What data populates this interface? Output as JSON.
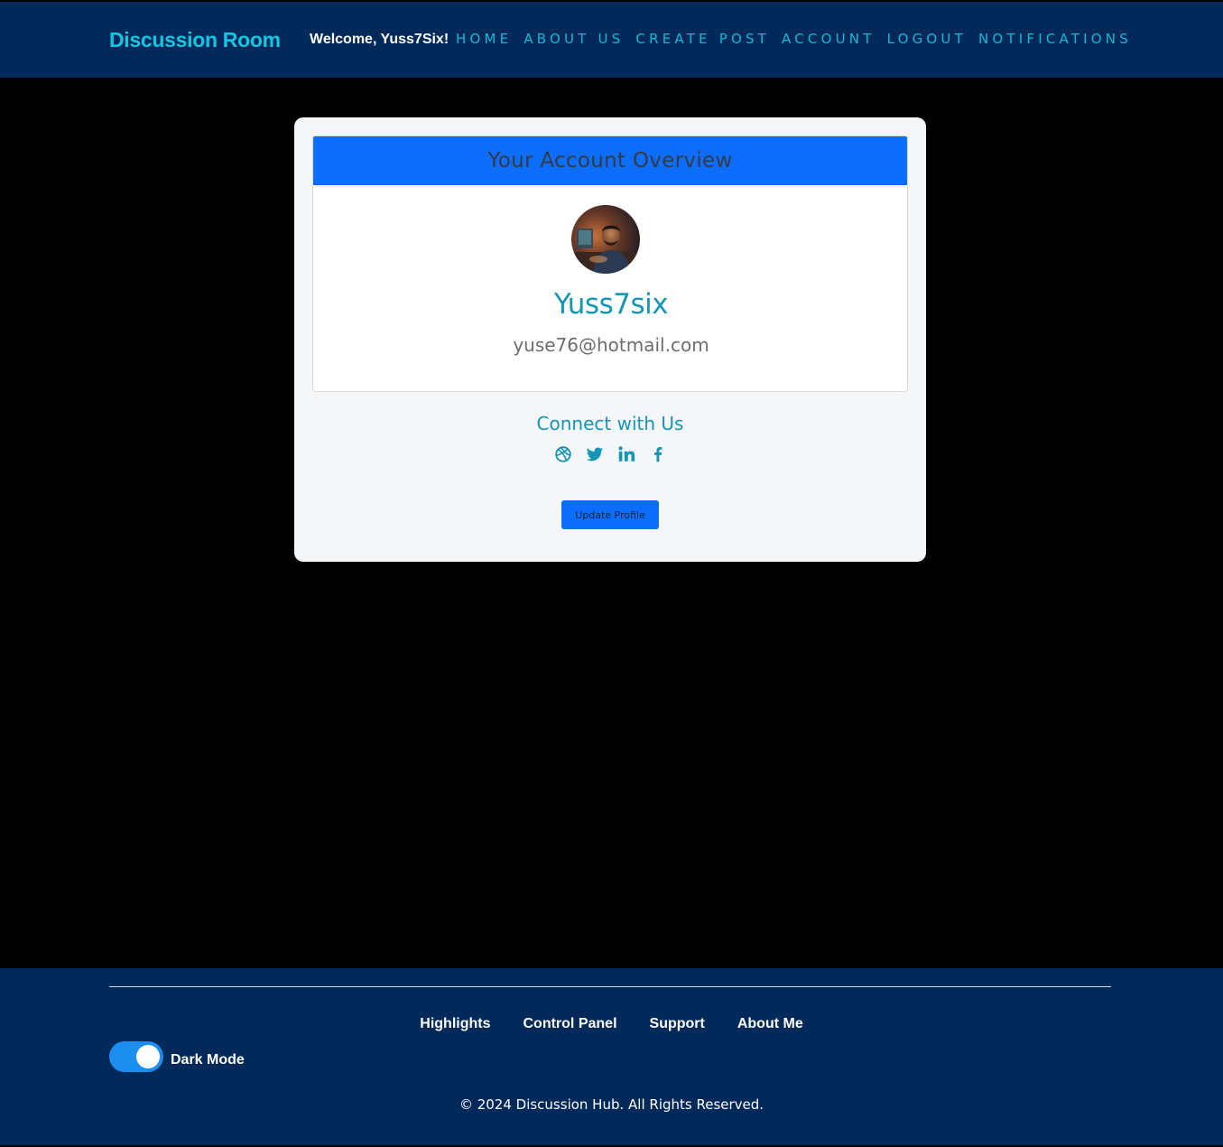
{
  "navbar": {
    "brand": "Discussion Room",
    "welcome": "Welcome, Yuss7Six!",
    "links": [
      "HOME",
      "ABOUT US",
      "CREATE POST",
      "ACCOUNT",
      "LOGOUT",
      "NOTIFICATIONS"
    ]
  },
  "account": {
    "header": "Your Account Overview",
    "username": "Yuss7six",
    "email": "yuse76@hotmail.com",
    "connect_title": "Connect with Us",
    "social_icons": [
      "dribbble-icon",
      "twitter-icon",
      "linkedin-icon",
      "facebook-icon"
    ],
    "update_button": "Update Profile"
  },
  "footer": {
    "links": [
      "Highlights",
      "Control Panel",
      "Support",
      "About Me"
    ],
    "dark_mode_label": "Dark Mode",
    "dark_mode_on": true,
    "copyright": "© 2024 Discussion Hub. All Rights Reserved."
  },
  "colors": {
    "navbar_bg": "#01295a",
    "brand": "#16c5e2",
    "accent": "#1595b5",
    "primary_button": "#0d6efd",
    "page_bg": "#000000"
  }
}
